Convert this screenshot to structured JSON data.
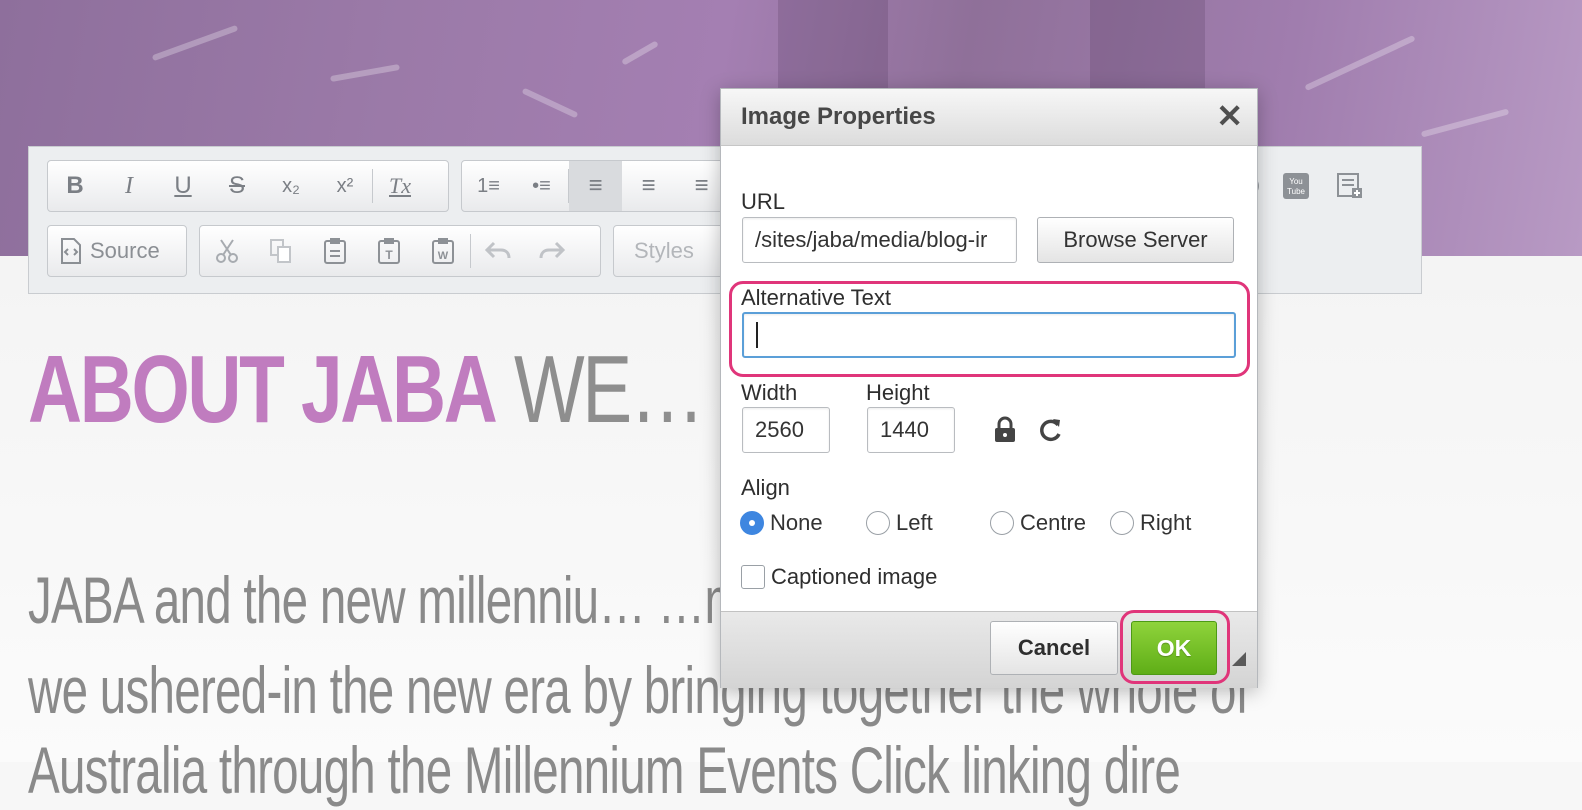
{
  "headline": {
    "bold": "ABOUT JABA",
    "light": " WE… …GN IN A"
  },
  "body_text": {
    "line1": "JABA and the new millenniu…                          …multaneously",
    "line2": "we ushered-in the new era by bringing together the whole of",
    "line3": "Australia through the Millennium Events Click linking dire"
  },
  "toolbar": {
    "row1": {
      "bold": "B",
      "italic": "I",
      "underline": "U",
      "strike": "S",
      "subscript": "x₂",
      "superscript": "x²",
      "remove_format": "Tx",
      "numbered_list": "1≡",
      "bulleted_list": "•≡",
      "align_left": "≡",
      "align_center": "≡",
      "align_right": "≡"
    },
    "row2": {
      "source_label": "Source",
      "styles_placeholder": "Styles"
    }
  },
  "dialog": {
    "title": "Image Properties",
    "close": "✕",
    "url_label": "URL",
    "url_value": "/sites/jaba/media/blog-ir",
    "browse_label": "Browse Server",
    "alt_label": "Alternative Text",
    "alt_value": "",
    "width_label": "Width",
    "width_value": "2560",
    "height_label": "Height",
    "height_value": "1440",
    "align_label": "Align",
    "align_options": [
      "None",
      "Left",
      "Centre",
      "Right"
    ],
    "align_selected": "None",
    "captioned_label": "Captioned image",
    "cancel_label": "Cancel",
    "ok_label": "OK"
  },
  "colors": {
    "headline_pink": "#c07cbf",
    "highlight": "#e0357a",
    "ok_green": "#6cbf20",
    "radio_blue": "#3e86e0"
  }
}
